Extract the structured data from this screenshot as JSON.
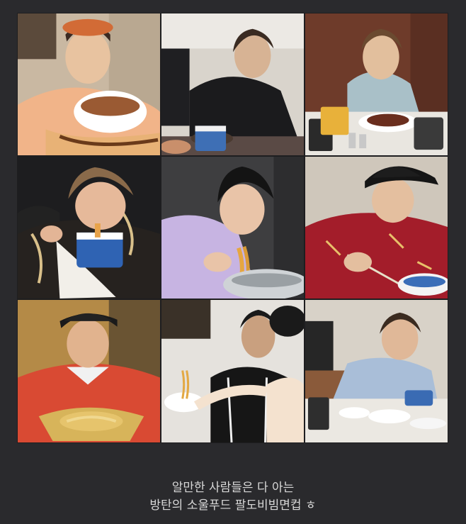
{
  "photos": [
    {
      "subject": "person eating noodles from a white bowl",
      "icon": "photo-icon"
    },
    {
      "subject": "person eating cup noodles at a table",
      "icon": "photo-icon"
    },
    {
      "subject": "person seated at table with steak and cup noodles",
      "icon": "photo-icon"
    },
    {
      "subject": "person eating noodles from a cup",
      "icon": "photo-icon"
    },
    {
      "subject": "person eating noodles from a silver bowl",
      "icon": "photo-icon"
    },
    {
      "subject": "person in cap eating from a blue cup",
      "icon": "photo-icon"
    },
    {
      "subject": "person holding a gold bowl of noodles",
      "icon": "photo-icon"
    },
    {
      "subject": "two people eating noodles together",
      "icon": "photo-icon"
    },
    {
      "subject": "person eating at a dining table",
      "icon": "photo-icon"
    }
  ],
  "caption": {
    "line1": "알만한 사람들은 다 아는",
    "line2": "방탄의 소울푸드 팔도비빔면컵 ㅎ"
  },
  "colors": {
    "background": "#2a2a2d",
    "caption_text": "#d8d8d8"
  }
}
